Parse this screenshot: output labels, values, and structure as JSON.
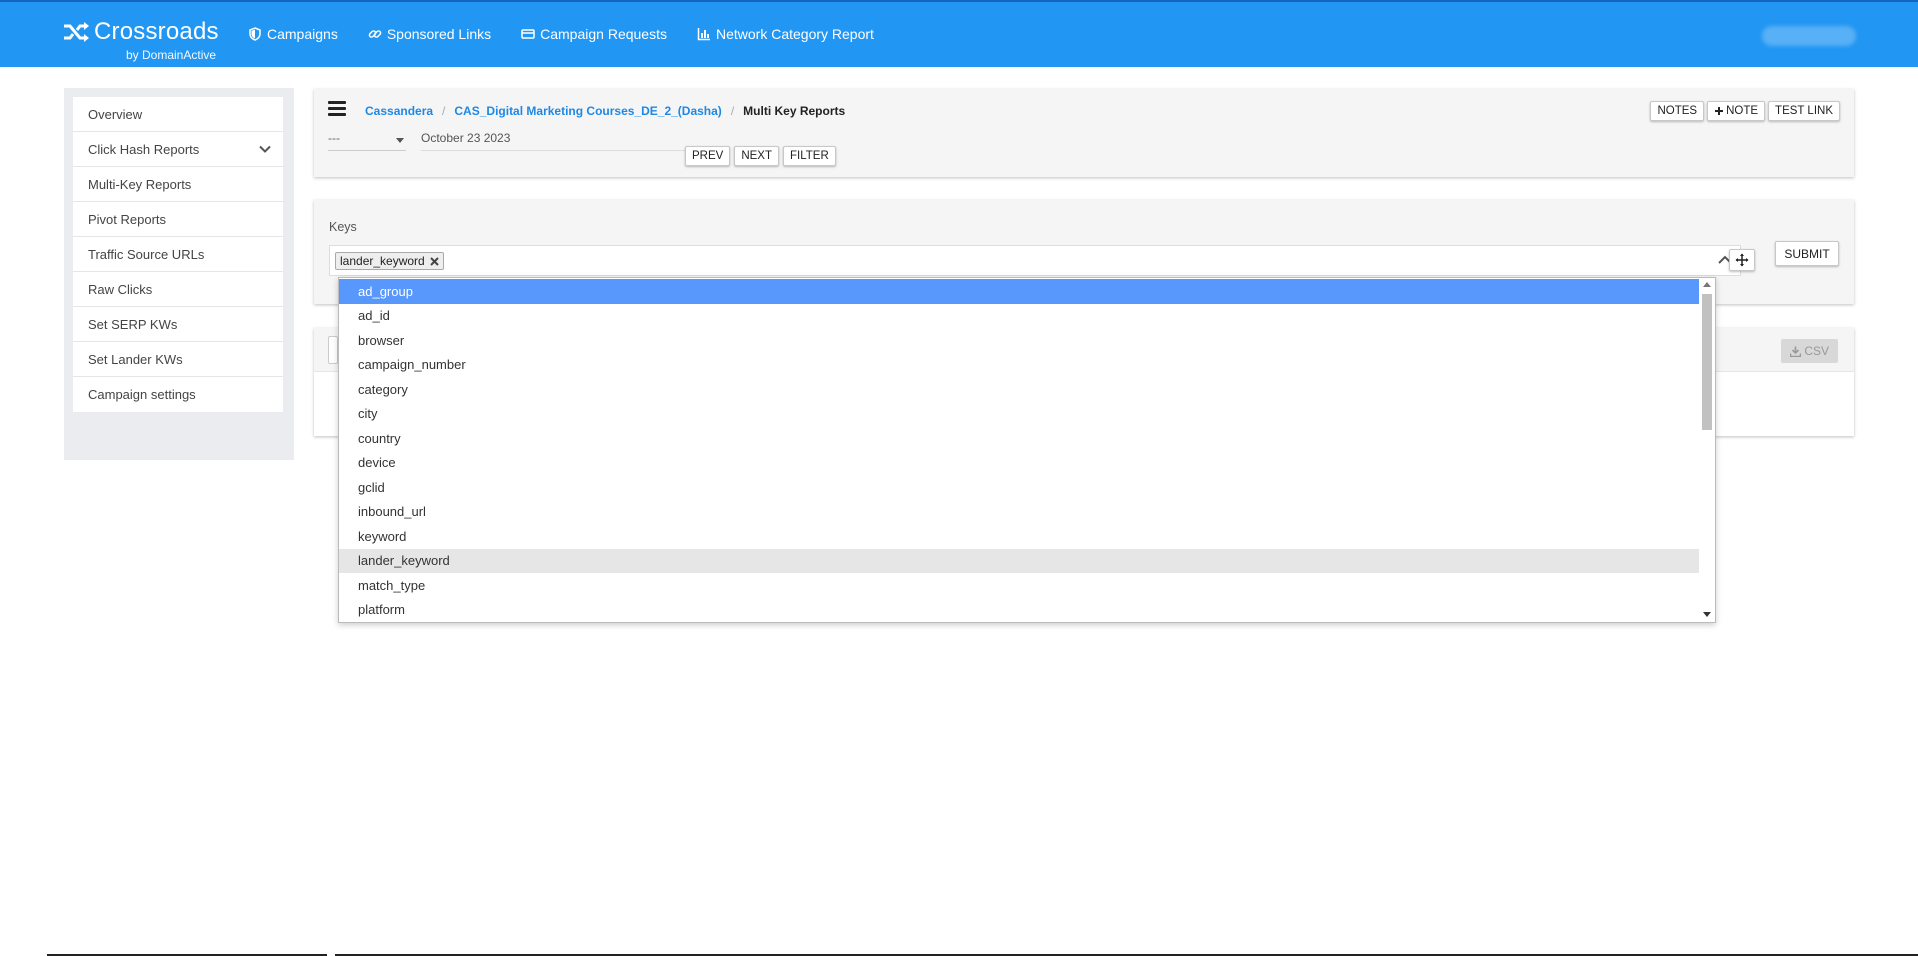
{
  "brand": {
    "name": "Crossroads",
    "sub": "by DomainActive"
  },
  "topnav": [
    {
      "label": "Campaigns",
      "icon": "shield-icon"
    },
    {
      "label": "Sponsored Links",
      "icon": "link-icon"
    },
    {
      "label": "Campaign Requests",
      "icon": "card-icon"
    },
    {
      "label": "Network Category Report",
      "icon": "chart-icon"
    }
  ],
  "sidebar": {
    "items": [
      {
        "label": "Overview"
      },
      {
        "label": "Click Hash Reports"
      },
      {
        "label": "Multi-Key Reports"
      },
      {
        "label": "Pivot Reports"
      },
      {
        "label": "Traffic Source URLs"
      },
      {
        "label": "Raw Clicks"
      },
      {
        "label": "Set SERP KWs"
      },
      {
        "label": "Set Lander KWs"
      },
      {
        "label": "Campaign settings"
      }
    ]
  },
  "breadcrumb": {
    "items": [
      "Cassandera",
      "CAS_Digital Marketing Courses_DE_2_(Dasha)"
    ],
    "current": "Multi Key Reports"
  },
  "header": {
    "notes_label": "NOTES",
    "add_note_label": "NOTE",
    "test_link_label": "TEST LINK",
    "period_value": "---",
    "date_value": "October 23 2023",
    "prev_label": "PREV",
    "next_label": "NEXT",
    "filter_label": "FILTER"
  },
  "keys": {
    "label": "Keys",
    "selected_tag": "lander_keyword",
    "submit_label": "SUBMIT"
  },
  "results": {
    "csv_label": "CSV"
  },
  "dropdown": {
    "options": [
      "ad_group",
      "ad_id",
      "browser",
      "campaign_number",
      "category",
      "city",
      "country",
      "device",
      "gclid",
      "inbound_url",
      "keyword",
      "lander_keyword",
      "match_type",
      "platform"
    ],
    "highlighted": "ad_group",
    "selected": "lander_keyword"
  },
  "colors": {
    "topbar": "#2196f3",
    "highlight": "#5897fb",
    "link": "#1e88e5"
  }
}
